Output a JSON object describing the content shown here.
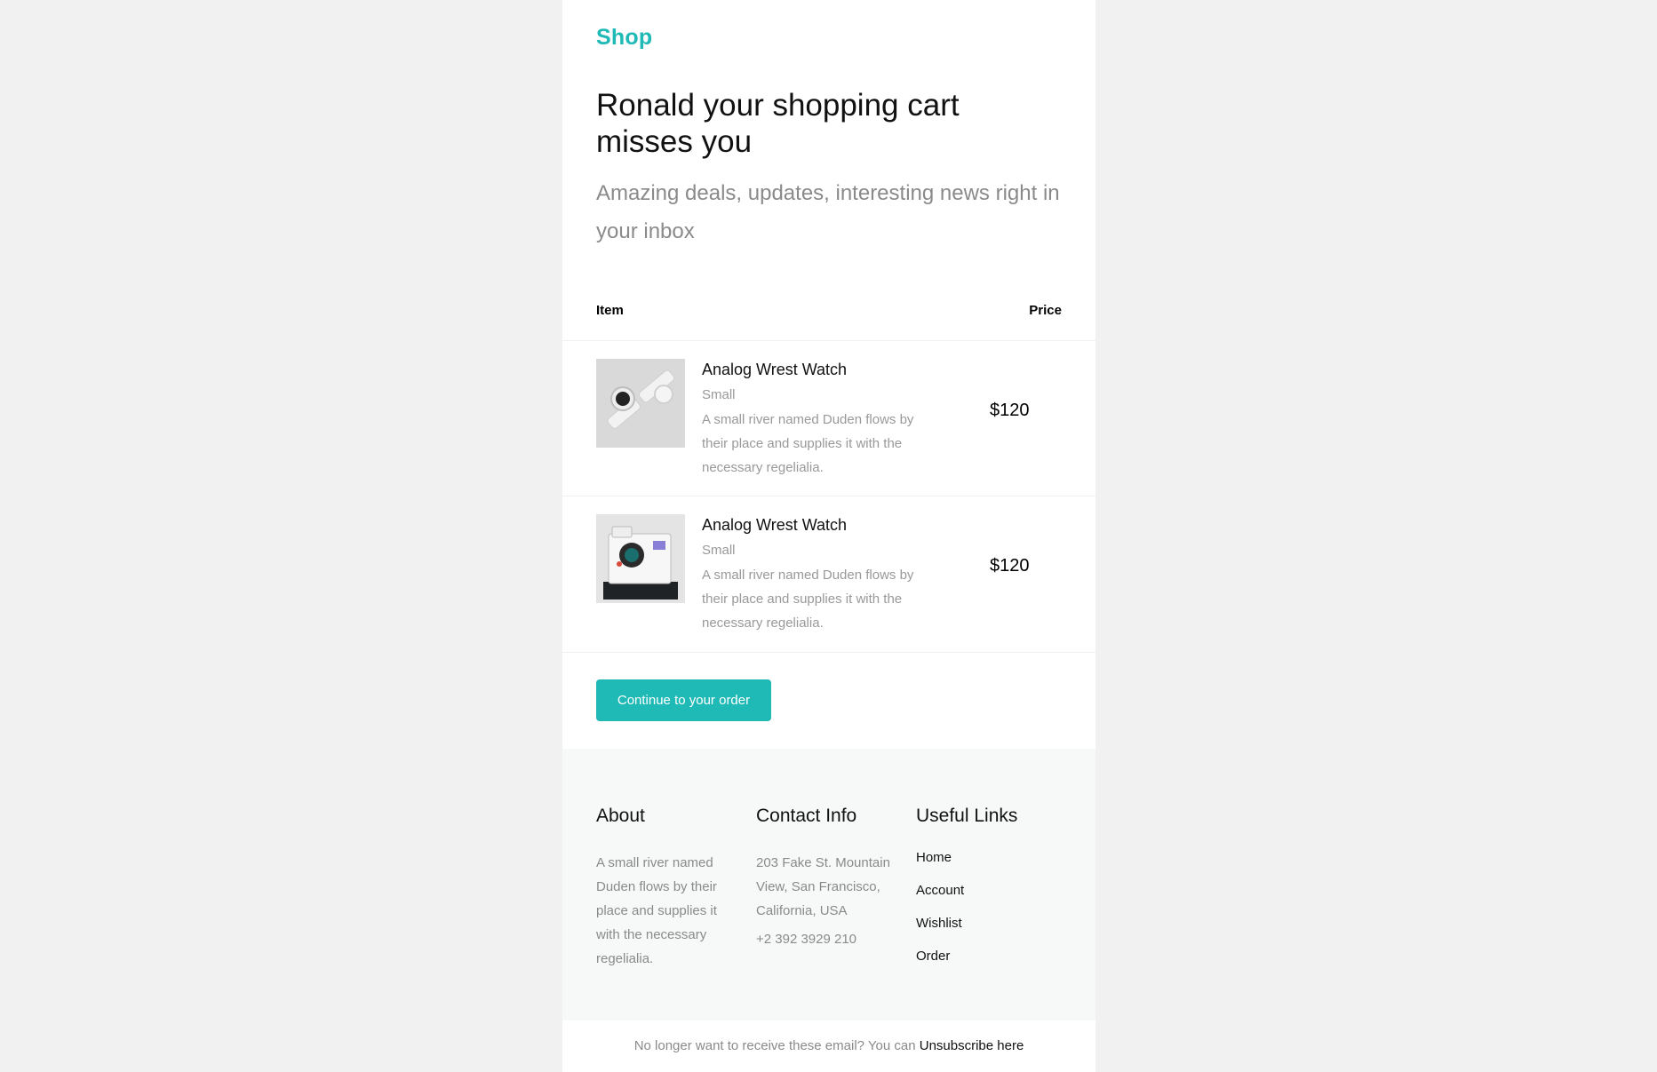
{
  "brand": {
    "name": "Shop",
    "color": "#1fb9b6"
  },
  "hero": {
    "title": "Ronald your shopping cart misses you",
    "subtitle": "Amazing deals, updates, interesting news right in your inbox"
  },
  "table": {
    "item_header": "Item",
    "price_header": "Price"
  },
  "items": [
    {
      "image_icon": "watch-image",
      "name": "Analog Wrest Watch",
      "size": "Small",
      "description": "A small river named Duden flows by their place and supplies it with the necessary regelialia.",
      "price": "$120"
    },
    {
      "image_icon": "camera-image",
      "name": "Analog Wrest Watch",
      "size": "Small",
      "description": "A small river named Duden flows by their place and supplies it with the necessary regelialia.",
      "price": "$120"
    }
  ],
  "cta": {
    "label": "Continue to your order"
  },
  "footer": {
    "about": {
      "heading": "About",
      "text": "A small river named Duden flows by their place and supplies it with the necessary regelialia."
    },
    "contact": {
      "heading": "Contact Info",
      "address": "203 Fake St. Mountain View, San Francisco, California, USA",
      "phone": "+2 392 3929 210"
    },
    "links": {
      "heading": "Useful Links",
      "items": [
        "Home",
        "Account",
        "Wishlist",
        "Order"
      ]
    }
  },
  "unsubscribe": {
    "text": "No longer want to receive these email? You can ",
    "link": "Unsubscribe here"
  }
}
